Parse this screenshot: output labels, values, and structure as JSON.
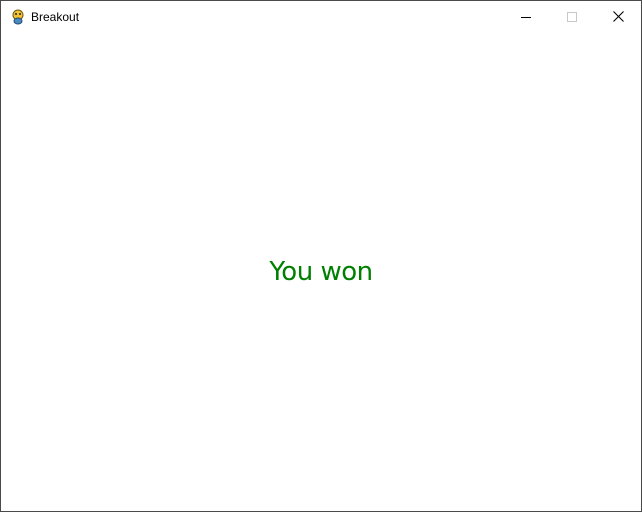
{
  "window": {
    "title": "Breakout",
    "app_icon": "pygame-snake-icon",
    "controls": [
      "minimize-icon",
      "maximize-icon",
      "close-icon"
    ]
  },
  "game": {
    "message": "You won",
    "message_color": "#008000",
    "background_color": "#ffffff"
  }
}
